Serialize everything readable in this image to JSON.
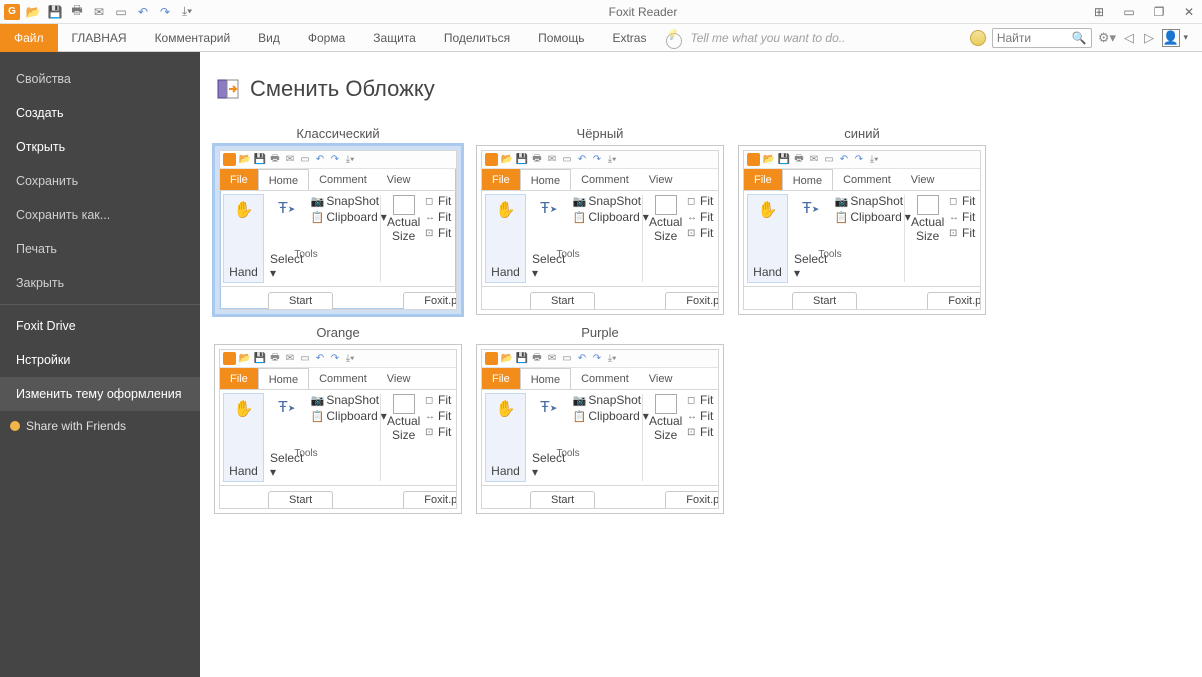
{
  "app": {
    "title": "Foxit Reader"
  },
  "quick_access": {
    "logo": "G",
    "icons": [
      "folder-open-icon",
      "save-icon",
      "print-icon",
      "mail-icon",
      "blank-icon",
      "undo-icon",
      "redo-icon",
      "scroll-mode-icon"
    ]
  },
  "ribbon": {
    "file": "Файл",
    "tabs": [
      "ГЛАВНАЯ",
      "Комментарий",
      "Вид",
      "Форма",
      "Защита",
      "Поделиться",
      "Помощь",
      "Extras"
    ],
    "tell_me_placeholder": "Tell me what you want to do..",
    "search_placeholder": "Найти"
  },
  "sidebar": {
    "items": [
      {
        "label": "Свойства",
        "enabled": false
      },
      {
        "label": "Создать",
        "enabled": true
      },
      {
        "label": "Открыть",
        "enabled": true
      },
      {
        "label": "Сохранить",
        "enabled": false
      },
      {
        "label": "Сохранить как...",
        "enabled": false
      },
      {
        "label": "Печать",
        "enabled": false
      },
      {
        "label": "Закрыть",
        "enabled": false
      }
    ],
    "items2": [
      {
        "label": "Foxit Drive",
        "enabled": true
      },
      {
        "label": "Нстройки",
        "enabled": true
      },
      {
        "label": "Изменить тему оформления",
        "enabled": true,
        "highlight": true
      }
    ],
    "share": "Share with Friends"
  },
  "page": {
    "title": "Сменить Обложку"
  },
  "themes": [
    {
      "name": "Классический",
      "selected": true
    },
    {
      "name": "Чёрный",
      "selected": false
    },
    {
      "name": "синий",
      "selected": false
    },
    {
      "name": "Orange",
      "selected": false
    },
    {
      "name": "Purple",
      "selected": false
    }
  ],
  "preview": {
    "tabs": {
      "file": "File",
      "home": "Home",
      "comment": "Comment",
      "view": "View"
    },
    "tools": {
      "hand": "Hand",
      "select": "Select",
      "snapshot": "SnapShot",
      "clipboard": "Clipboard",
      "actual_size": "Actual Size",
      "actual": "Actual",
      "size": "Size",
      "fit": "Fit",
      "tools_label": "Tools"
    },
    "doc_tabs": {
      "start": "Start",
      "file": "Foxit.pdf"
    }
  }
}
